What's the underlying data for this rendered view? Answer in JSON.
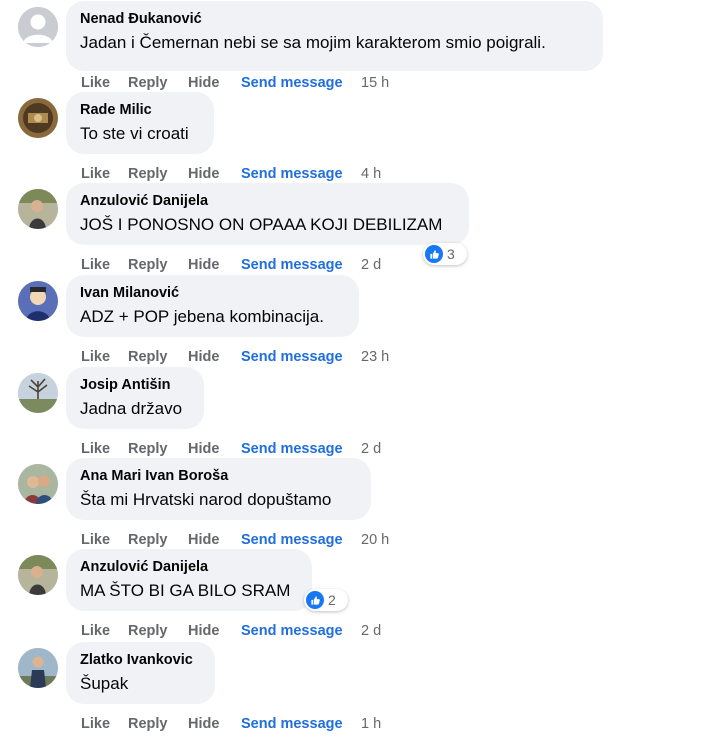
{
  "actions": {
    "like": "Like",
    "reply": "Reply",
    "hide": "Hide",
    "send_message": "Send message"
  },
  "colors": {
    "bubble_bg": "#f0f2f5",
    "action_gray": "#65676b",
    "send_message_blue": "#216fdb",
    "like_blue": "#1877f2"
  },
  "comments": [
    {
      "author": "Nenad Đukanović",
      "text": "Jadan i Čemernan nebi se sa mojim karakterom smio poigrali.",
      "time": "15 h",
      "avatar": "default-avatar-icon"
    },
    {
      "author": "Rade Milic",
      "text": "To ste vi croati",
      "time": "4 h",
      "avatar": "profile-photo"
    },
    {
      "author": "Anzulović Danijela",
      "text": "JOŠ I PONOSNO ON OPAAA KOJI DEBILIZAM",
      "time": "2 d",
      "avatar": "profile-photo",
      "reactions": "3",
      "reaction_icon": "like-icon"
    },
    {
      "author": "Ivan Milanović",
      "text": "ADZ + POP jebena kombinacija.",
      "time": "23 h",
      "avatar": "profile-photo"
    },
    {
      "author": "Josip Antišin",
      "text": "Jadna državo",
      "time": "2 d",
      "avatar": "profile-photo"
    },
    {
      "author": "Ana Mari Ivan Boroša",
      "text": "Šta mi Hrvatski narod dopuštamo",
      "time": "20 h",
      "avatar": "profile-photo"
    },
    {
      "author": "Anzulović Danijela",
      "text": "MA ŠTO BI GA BILO SRAM",
      "time": "2 d",
      "avatar": "profile-photo",
      "reactions": "2",
      "reaction_icon": "like-icon"
    },
    {
      "author": "Zlatko Ivankovic",
      "text": "Šupak",
      "time": "1 h",
      "avatar": "profile-photo"
    }
  ]
}
